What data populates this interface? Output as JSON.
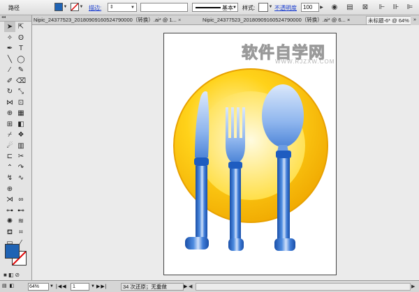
{
  "control_bar": {
    "path_label": "路径",
    "stroke_label": "描边:",
    "brush_label": "基本",
    "style_label": "样式:",
    "opacity_label": "不透明度",
    "opacity_value": "100",
    "fill_color": "#1f63b4"
  },
  "tabs": [
    {
      "label": "Nipic_24377523_20180909160524790000（转换）.ai* @ 1...",
      "close": "×"
    },
    {
      "label": "Nipic_24377523_20180909160524790000（转换）.ai* @ 6...",
      "close": "×"
    },
    {
      "label": "未标题-6* @ 64% ("
    }
  ],
  "watermark": {
    "title": "软件自学网",
    "url": "WWW.RJZXW.COM"
  },
  "status_bar": {
    "zoom": "64%",
    "page": "1",
    "status_text": "34 次还原；无重做"
  },
  "artwork": {
    "plate_color": "#f5bc00",
    "utensil_color": "#2f6fd0",
    "utensil_light": "#c9dcf7"
  }
}
